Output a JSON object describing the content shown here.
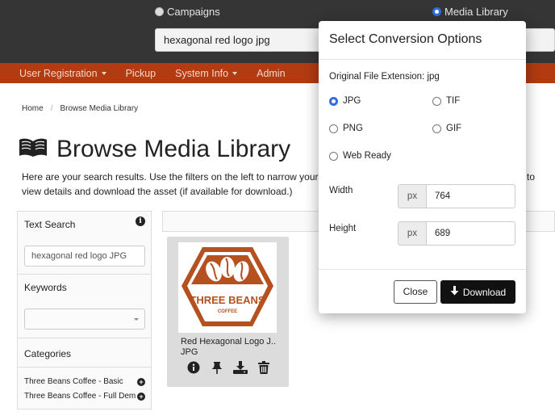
{
  "search": {
    "mode_options": [
      {
        "label": "Campaigns",
        "selected": false
      },
      {
        "label": "Media Library",
        "selected": true
      }
    ],
    "query": "hexagonal red logo jpg"
  },
  "nav": {
    "items": [
      {
        "label": "User Registration",
        "has_dropdown": true
      },
      {
        "label": "Pickup",
        "has_dropdown": false
      },
      {
        "label": "System Info",
        "has_dropdown": true
      },
      {
        "label": "Admin",
        "has_dropdown": false
      }
    ]
  },
  "breadcrumb": [
    "Home",
    "Browse Media Library"
  ],
  "page": {
    "title": "Browse Media Library",
    "title_icon": "open-book-icon",
    "intro_line1": "Here are your search results. Use the filters on the left to narrow your sea",
    "intro_line1_tail": "to",
    "intro_line2": "view details and download the asset (if available for download.)"
  },
  "filters": {
    "text_search": {
      "label": "Text Search",
      "value": "hexagonal red logo JPG"
    },
    "keywords": {
      "label": "Keywords",
      "value": ""
    },
    "categories": {
      "label": "Categories",
      "items": [
        "Three Beans Coffee - Basic",
        "Three Beans Coffee - Full Dem"
      ]
    }
  },
  "asset": {
    "name_line1": "Red Hexagonal Logo J..",
    "name_line2": "JPG",
    "logo_text_main": "THREE BEANS",
    "logo_text_sub": "COFFEE",
    "actions": [
      "info-icon",
      "pin-icon",
      "download-icon",
      "trash-icon"
    ]
  },
  "modal": {
    "title": "Select Conversion Options",
    "original_extension_label": "Original File Extension: jpg",
    "formats": [
      {
        "label": "JPG",
        "selected": true
      },
      {
        "label": "TIF",
        "selected": false
      },
      {
        "label": "PNG",
        "selected": false
      },
      {
        "label": "GIF",
        "selected": false
      },
      {
        "label": "Web Ready",
        "selected": false
      }
    ],
    "width": {
      "label": "Width",
      "unit": "px",
      "value": "764"
    },
    "height": {
      "label": "Height",
      "unit": "px",
      "value": "689"
    },
    "close_label": "Close",
    "download_label": "Download"
  },
  "colors": {
    "nav_bg": "#b23b11",
    "topbar_bg": "#353535",
    "brand_orange": "#b5501f",
    "radio_accent": "#2f6ee0"
  }
}
